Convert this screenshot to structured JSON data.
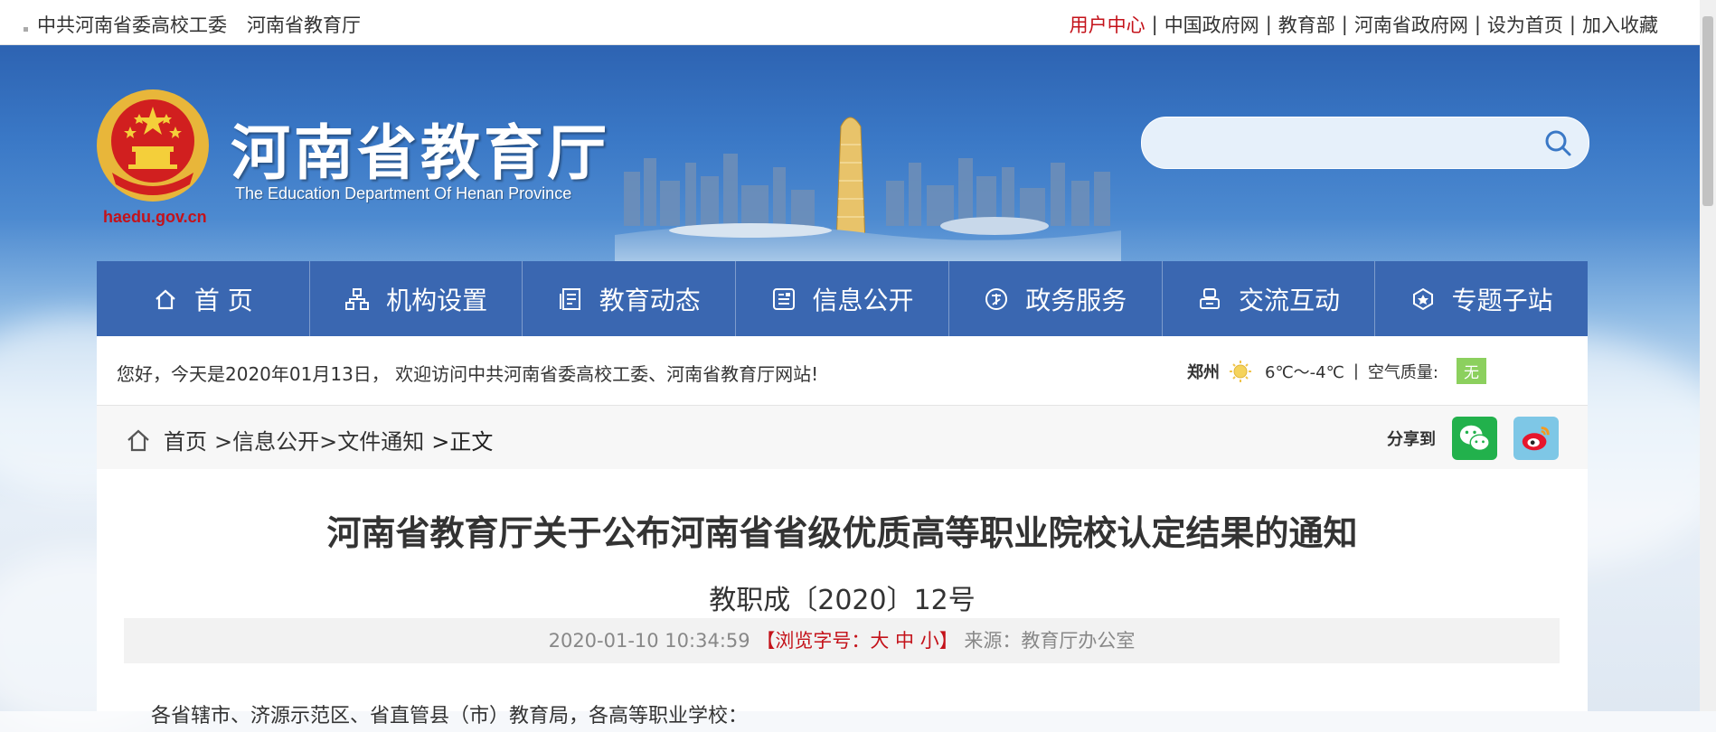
{
  "topbar": {
    "left_links": [
      "中共河南省委高校工委",
      "河南省教育厅"
    ],
    "right_links": [
      {
        "label": "用户中心",
        "highlight": true
      },
      {
        "label": "中国政府网",
        "highlight": false
      },
      {
        "label": "教育部",
        "highlight": false
      },
      {
        "label": "河南省政府网",
        "highlight": false
      },
      {
        "label": "设为首页",
        "highlight": false
      },
      {
        "label": "加入收藏",
        "highlight": false
      }
    ],
    "separator": "|"
  },
  "header": {
    "site_title": "河南省教育厅",
    "site_subtitle": "The Education Department Of Henan Province",
    "site_url": "haedu.gov.cn",
    "search_placeholder": ""
  },
  "nav": {
    "items": [
      {
        "label": "首 页",
        "icon": "home-icon"
      },
      {
        "label": "机构设置",
        "icon": "org-chart-icon"
      },
      {
        "label": "教育动态",
        "icon": "news-icon"
      },
      {
        "label": "信息公开",
        "icon": "info-card-icon"
      },
      {
        "label": "政务服务",
        "icon": "gov-service-icon"
      },
      {
        "label": "交流互动",
        "icon": "interaction-icon"
      },
      {
        "label": "专题子站",
        "icon": "subsite-icon"
      }
    ]
  },
  "greeting": {
    "message": "您好，今天是2020年01月13日， 欢迎访问中共河南省委高校工委、河南省教育厅网站!",
    "city": "郑州",
    "temperature": "6℃～-4℃",
    "sep": "|",
    "air_quality_label": "空气质量:",
    "air_quality_value": "无"
  },
  "breadcrumb": {
    "items": [
      "首页",
      ">信息公开",
      ">文件通知",
      ">正文"
    ]
  },
  "share": {
    "label": "分享到",
    "targets": [
      "wechat",
      "weibo"
    ]
  },
  "article": {
    "title": "河南省教育厅关于公布河南省省级优质高等职业院校认定结果的通知",
    "doc_number": "教职成〔2020〕12号",
    "datetime": "2020-01-10 10:34:59",
    "font_size_prefix": "【浏览字号：",
    "font_sizes": [
      "大",
      "中",
      "小"
    ],
    "font_size_suffix": "】",
    "source": "来源：教育厅办公室",
    "first_line": "各省辖市、济源示范区、省直管县（市）教育局，各高等职业学校："
  },
  "colors": {
    "nav_bg": "#3a67b1",
    "accent_red": "#c4121a",
    "air_quality_green": "#8cd05e"
  }
}
